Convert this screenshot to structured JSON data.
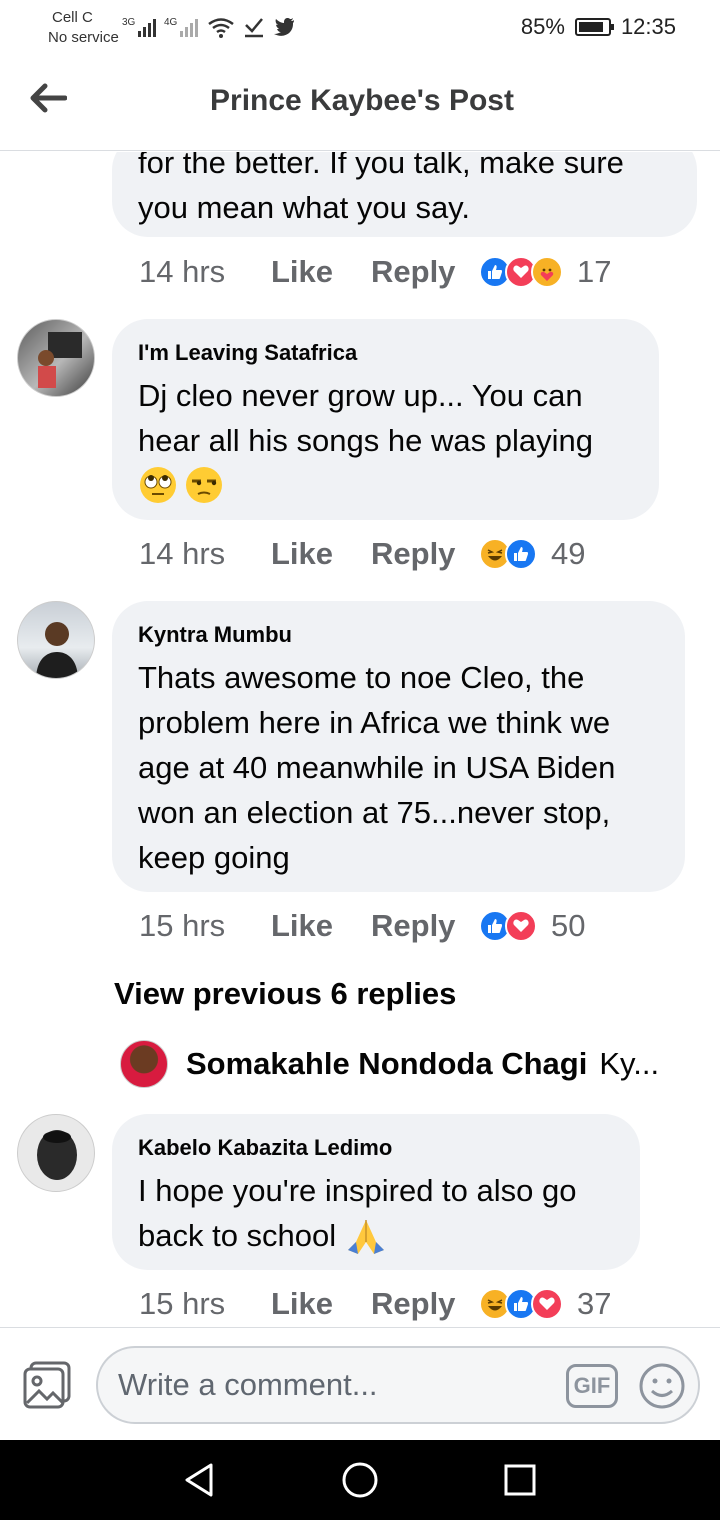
{
  "status_bar": {
    "carrier": "Cell C",
    "service": "No service",
    "net1": "3G",
    "net2": "4G",
    "battery_text": "85%",
    "battery_level": 0.85,
    "time": "12:35"
  },
  "header": {
    "title": "Prince Kaybee's Post"
  },
  "comments": [
    {
      "text_line1": "for the better. If you talk, make sure",
      "text_line2": "you mean what you say.",
      "time": "14 hrs",
      "like": "Like",
      "reply": "Reply",
      "reactions": [
        "like",
        "love",
        "care"
      ],
      "count": "17"
    },
    {
      "author": "I'm Leaving Satafrica",
      "text_line1": "Dj cleo never grow up... You can",
      "text_line2": "hear all his songs he was playing",
      "emojis": [
        "face-with-rolling-eyes",
        "unamused-face"
      ],
      "time": "14 hrs",
      "like": "Like",
      "reply": "Reply",
      "reactions": [
        "haha",
        "like"
      ],
      "count": "49"
    },
    {
      "author": "Kyntra Mumbu",
      "text_line1": "Thats awesome to noe Cleo, the",
      "text_line2": "problem here in Africa we think we",
      "text_line3": "age at 40 meanwhile in USA Biden",
      "text_line4": "won an election at 75...never stop,",
      "text_line5": "keep going",
      "time": "15 hrs",
      "like": "Like",
      "reply": "Reply",
      "reactions": [
        "like",
        "love"
      ],
      "count": "50"
    },
    {
      "author": "Kabelo Kabazita Ledimo",
      "text_line1": "I hope you're inspired to also go",
      "text_line2": "back to school",
      "emoji": "folded-hands",
      "time": "15 hrs",
      "like": "Like",
      "reply": "Reply",
      "reactions": [
        "haha",
        "like",
        "love"
      ],
      "count": "37"
    }
  ],
  "view_previous": "View previous 6 replies",
  "reply_preview": {
    "name": "Somakahle Nondoda Chagi",
    "snippet": "Ky..."
  },
  "composer": {
    "placeholder": "Write a comment...",
    "gif_label": "GIF"
  },
  "colors": {
    "accent": "#1877f2",
    "bubble": "#f0f2f5",
    "muted": "#65676b"
  }
}
